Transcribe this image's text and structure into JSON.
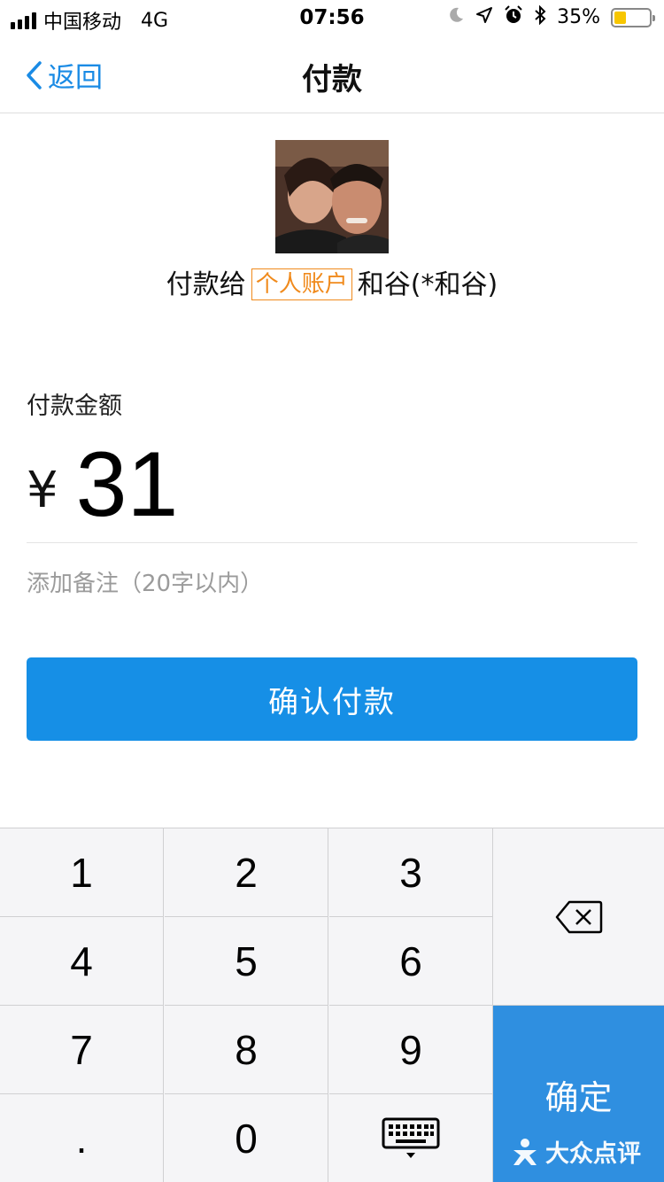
{
  "status_bar": {
    "carrier": "中国移动",
    "network": "4G",
    "time": "07:56",
    "battery": "35%",
    "battery_level": 0.35,
    "icons": [
      "moon-icon",
      "location-icon",
      "alarm-icon",
      "bluetooth-icon"
    ]
  },
  "nav": {
    "back_label": "返回",
    "title": "付款"
  },
  "payee": {
    "prefix": "付款给",
    "tag": "个人账户",
    "name": "和谷(*和谷)"
  },
  "amount": {
    "label": "付款金额",
    "currency": "¥",
    "value": "31"
  },
  "remark": {
    "placeholder": "添加备注（20字以内）"
  },
  "confirm_button": "确认付款",
  "keypad": {
    "keys": [
      "1",
      "2",
      "3",
      "4",
      "5",
      "6",
      "7",
      "8",
      "9",
      ".",
      "0"
    ],
    "ok_label": "确定",
    "delete_icon": "backspace-icon",
    "keyboard_icon": "keyboard-hide-icon"
  },
  "watermark": "大众点评",
  "colors": {
    "accent": "#168fe6",
    "tag": "#f08a1c",
    "ok_key": "#2f8fe0"
  }
}
